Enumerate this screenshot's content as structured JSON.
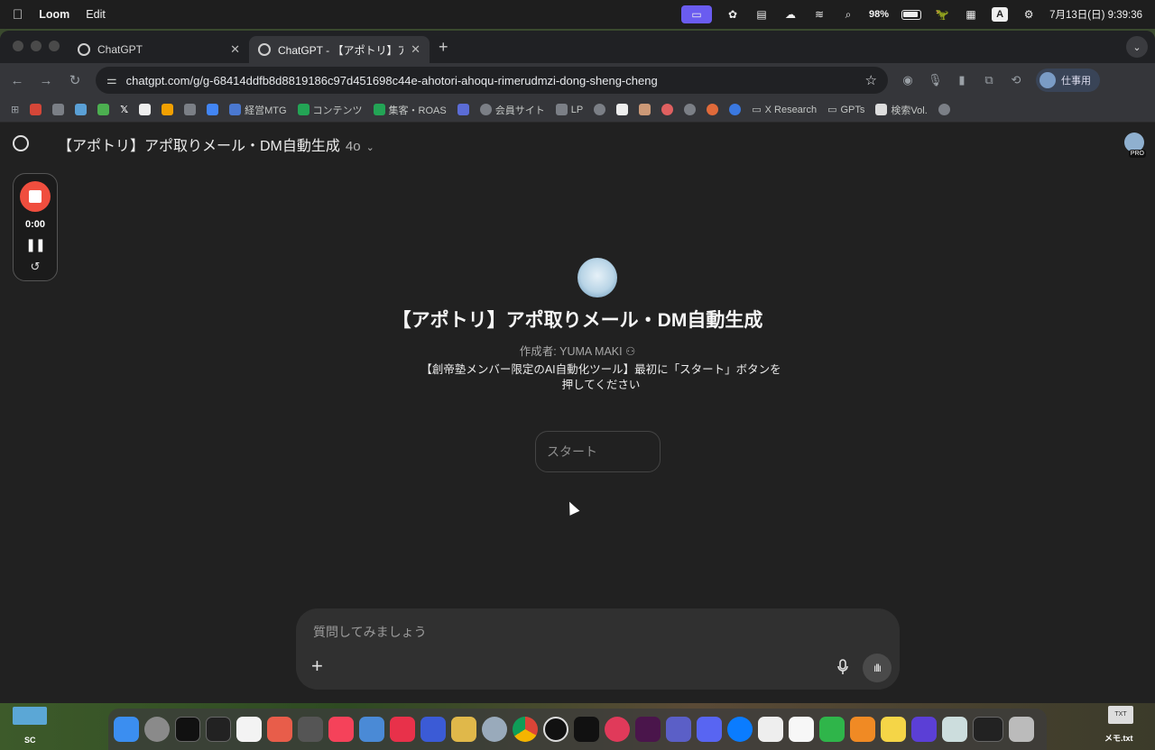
{
  "menubar": {
    "app_name": "Loom",
    "menu_edit": "Edit",
    "battery": "98%",
    "input_mode": "A",
    "datetime": "7月13日(日) 9:39:36"
  },
  "tabs": [
    {
      "label": "ChatGPT"
    },
    {
      "label": "ChatGPT - 【アポトリ】アポ取"
    }
  ],
  "toolbar": {
    "url": "chatgpt.com/g/g-68414ddfb8d8819186c97d451698c44e-ahotori-ahoqu-rimerudmzi-dong-sheng-cheng",
    "profile_label": "仕事用"
  },
  "bookmarks": [
    {
      "label": "経営MTG"
    },
    {
      "label": "コンテンツ"
    },
    {
      "label": "集客・ROAS"
    },
    {
      "label": "会員サイト"
    },
    {
      "label": "LP"
    },
    {
      "label": "X Research"
    },
    {
      "label": "GPTs"
    },
    {
      "label": "検索Vol."
    }
  ],
  "header": {
    "title": "【アポトリ】アポ取りメール・DM自動生成",
    "model": "4o",
    "pro_badge": "PRO"
  },
  "loom": {
    "time": "0:00"
  },
  "gpt": {
    "name": "【アポトリ】アポ取りメール・DM自動生成",
    "author": "作成者: YUMA MAKI",
    "description": "【創帝塾メンバー限定のAI自動化ツール】最初に「スタート」ボタンを押してください",
    "starter": "スタート"
  },
  "composer": {
    "placeholder": "質問してみましょう"
  },
  "desktop": {
    "left_label": "SC",
    "file_label": "メモ.txt",
    "file_icon_text": "TXT"
  },
  "colors": {
    "loom_accent": "#6a5cf0",
    "record_red": "#f04e3e",
    "page_bg": "#212121"
  }
}
